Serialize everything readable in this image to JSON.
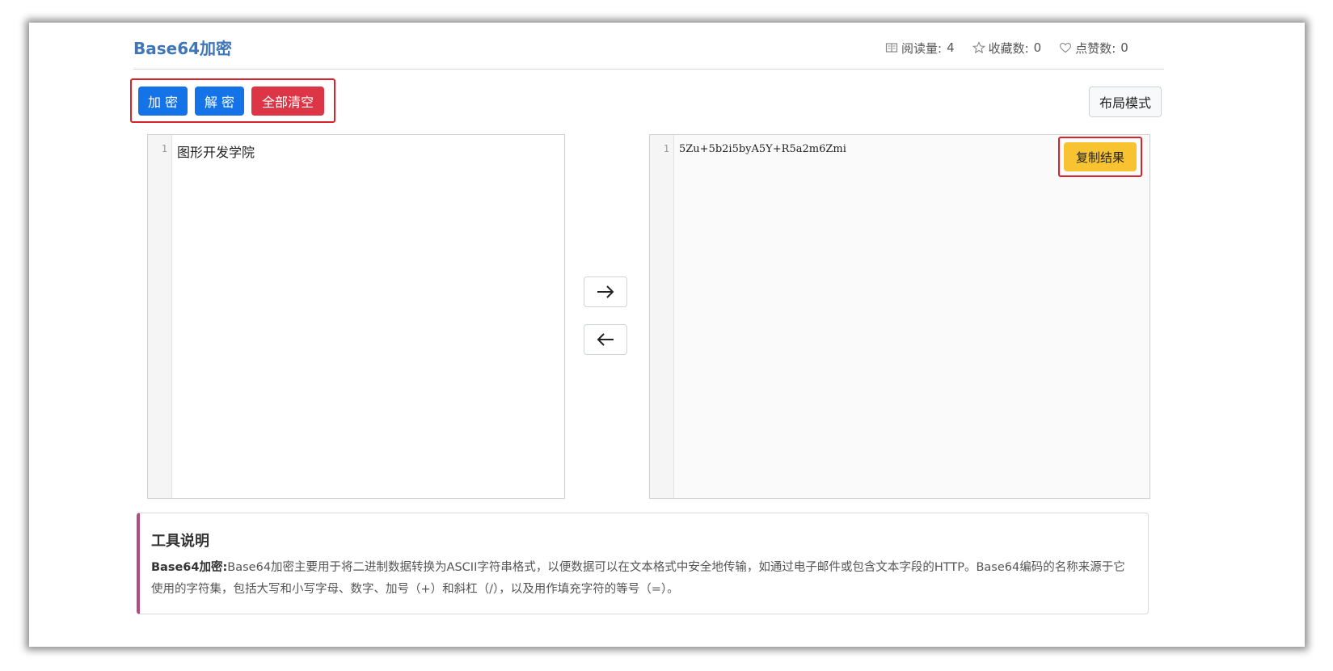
{
  "header": {
    "title": "Base64加密",
    "stats": {
      "read_label": "阅读量:",
      "read_value": "4",
      "fav_label": "收藏数:",
      "fav_value": "0",
      "like_label": "点赞数:",
      "like_value": "0"
    }
  },
  "toolbar": {
    "encode_label": "加 密",
    "decode_label": "解 密",
    "clear_label": "全部清空",
    "layout_label": "布局模式"
  },
  "input_editor": {
    "line_number": "1",
    "text": "图形开发学院"
  },
  "output_editor": {
    "line_number": "1",
    "text": "5Zu+5b2i5byA5Y+R5a2m6Zmi",
    "copy_label": "复制结果"
  },
  "description": {
    "title": "工具说明",
    "lead": "Base64加密:",
    "body": "Base64加密主要用于将二进制数据转换为ASCII字符串格式，以便数据可以在文本格式中安全地传输，如通过电子邮件或包含文本字段的HTTP。Base64编码的名称来源于它使用的字符集，包括大写和小写字母、数字、加号（+）和斜杠（/），以及用作填充字符的等号（=）。"
  },
  "colors": {
    "accent_blue": "#1473e6",
    "danger_red": "#dc3545",
    "copy_yellow": "#f7c331",
    "title_blue": "#3f76b7",
    "desc_border": "#b04c82"
  },
  "icons": {
    "read": "book-icon",
    "fav": "star-icon",
    "like": "heart-icon",
    "to_right": "arrow-right-icon",
    "to_left": "arrow-left-icon"
  }
}
